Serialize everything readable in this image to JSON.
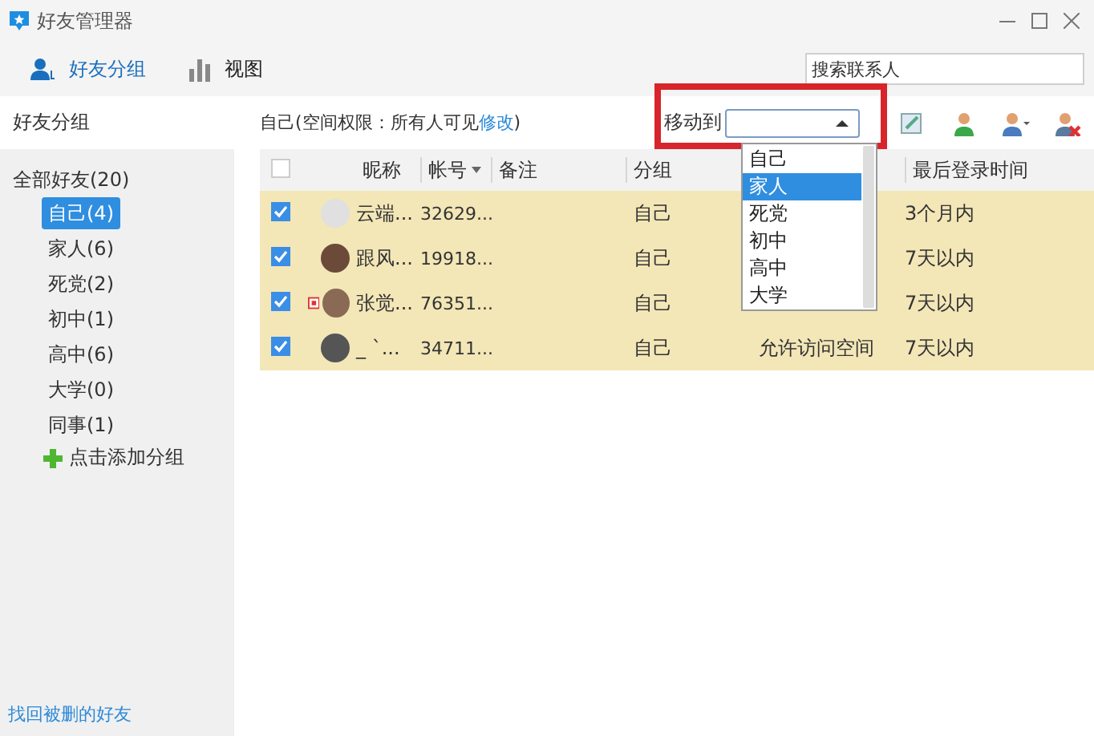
{
  "window": {
    "title": "好友管理器"
  },
  "toolbar": {
    "tabs": [
      {
        "label": "好友分组",
        "selected": true
      },
      {
        "label": "视图",
        "selected": false
      }
    ],
    "search": {
      "placeholder": "搜索联系人"
    }
  },
  "sidebar": {
    "header": "好友分组",
    "tree": {
      "label": "全部好友(20)",
      "children": [
        {
          "label": "自己(4)",
          "selected": true
        },
        {
          "label": "家人(6)",
          "selected": false
        },
        {
          "label": "死党(2)",
          "selected": false
        },
        {
          "label": "初中(1)",
          "selected": false
        },
        {
          "label": "高中(6)",
          "selected": false
        },
        {
          "label": "大学(0)",
          "selected": false
        },
        {
          "label": "同事(1)",
          "selected": false
        }
      ]
    },
    "add_group": "点击添加分组",
    "recover_link": "找回被删的好友"
  },
  "info": {
    "prefix": "自己(空间权限：所有人可见",
    "link": "修改",
    "suffix": ")"
  },
  "move_to": {
    "label": "移动到",
    "expanded": true,
    "options": [
      {
        "label": "自己",
        "selected": false
      },
      {
        "label": "家人",
        "selected": true
      },
      {
        "label": "死党",
        "selected": false
      },
      {
        "label": "初中",
        "selected": false
      },
      {
        "label": "高中",
        "selected": false
      },
      {
        "label": "大学",
        "selected": false
      }
    ]
  },
  "table": {
    "select_all": {
      "checked": false
    },
    "columns": [
      {
        "label": "昵称",
        "sorted": false
      },
      {
        "label": "帐号",
        "sorted": true
      },
      {
        "label": "备注",
        "sorted": false
      },
      {
        "label": "分组",
        "sorted": false
      },
      {
        "label": "最后登录时间",
        "sorted": false
      }
    ],
    "rows": [
      {
        "checked": true,
        "flagged": false,
        "name": "云端...",
        "account": "32629...",
        "group": "自己",
        "last_login": "3个月内"
      },
      {
        "checked": true,
        "flagged": false,
        "name": "跟风...",
        "account": "19918...",
        "group": "自己",
        "last_login": "7天以内"
      },
      {
        "checked": true,
        "flagged": true,
        "name": "张觉...",
        "account": "76351...",
        "group": "自己",
        "last_login": "7天以内"
      },
      {
        "checked": true,
        "flagged": false,
        "name": "_ `...",
        "account": "34711...",
        "group": "自己",
        "column_6": "允许访问空间",
        "last_login": "7天以内"
      }
    ]
  }
}
